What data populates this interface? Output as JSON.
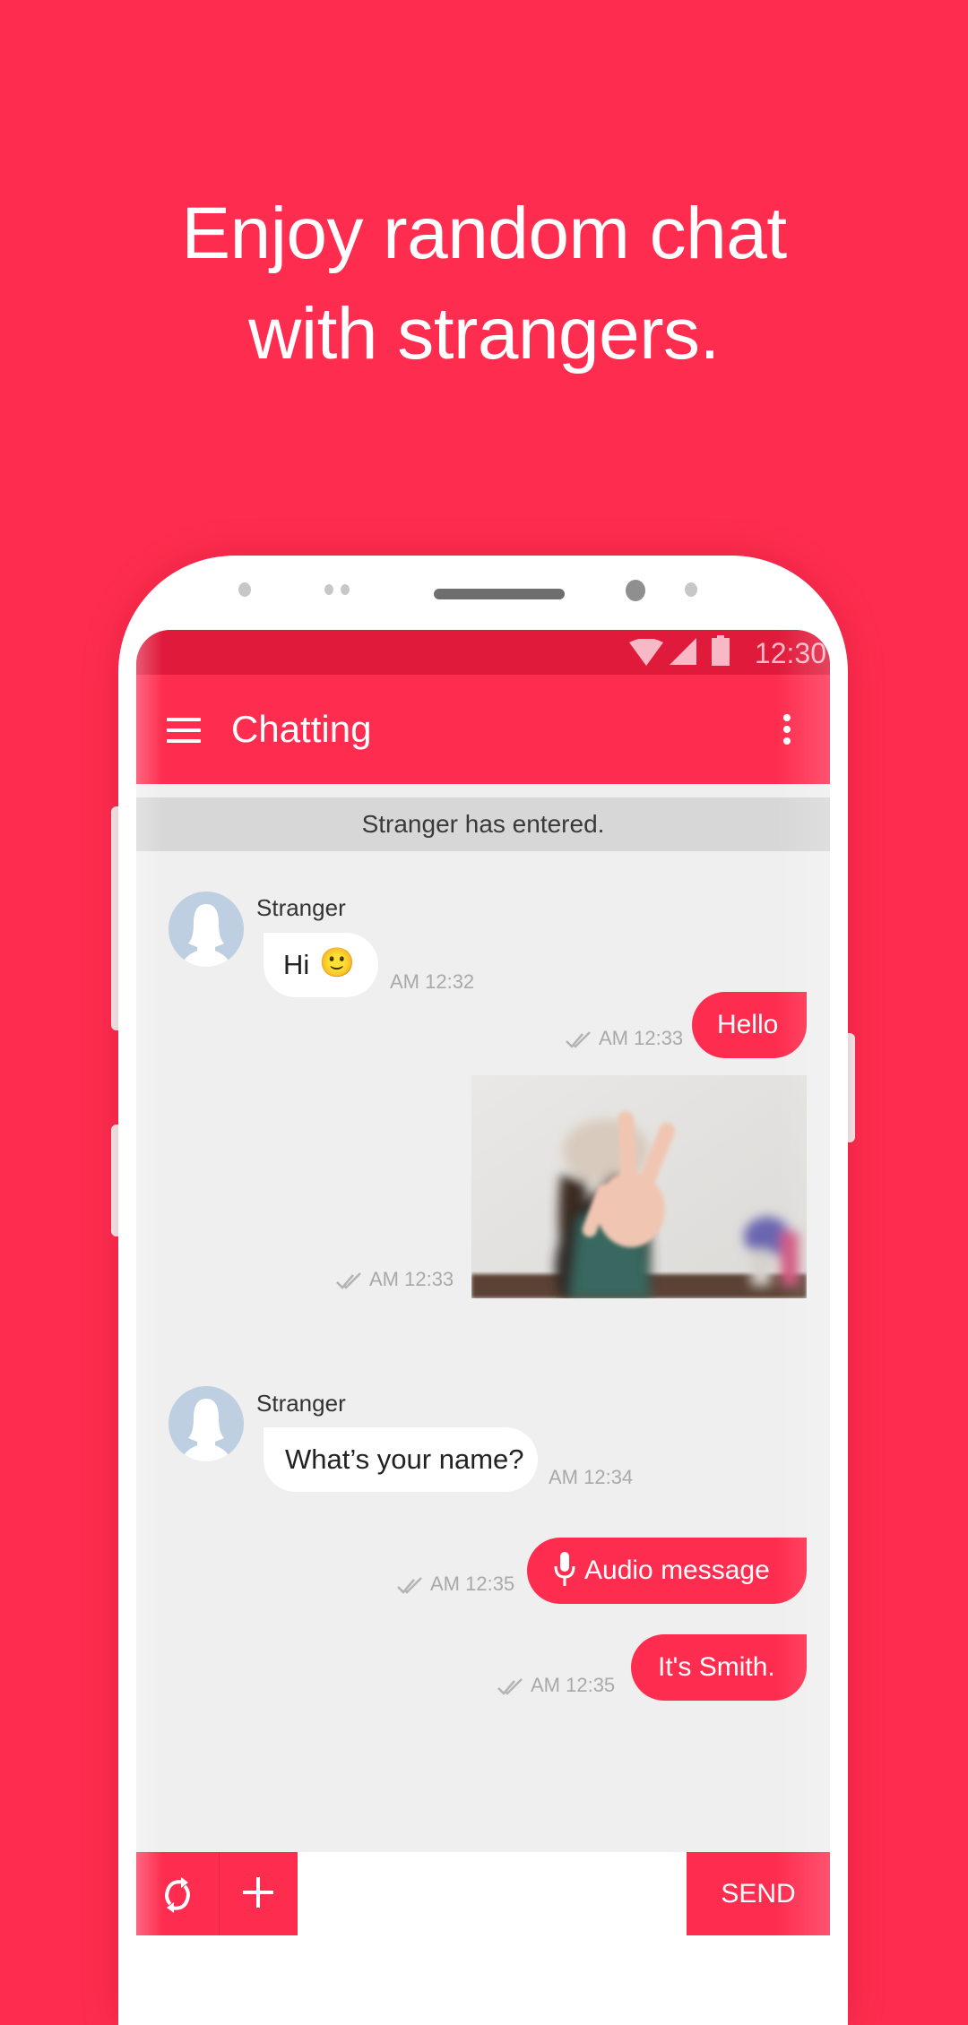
{
  "headline": {
    "line1": "Enjoy random chat",
    "line2": "with strangers."
  },
  "colors": {
    "brand": "#fe2d4f",
    "status_bar": "#e01a3b",
    "system_msg_bg": "#d7d7d7",
    "chat_bg": "#efefef"
  },
  "status_bar": {
    "icons": [
      "wifi-icon",
      "signal-icon",
      "battery-icon"
    ],
    "time": "12:30"
  },
  "app_bar": {
    "menu_icon": "hamburger-menu-icon",
    "title": "Chatting",
    "more_icon": "more-vertical-icon"
  },
  "chat": {
    "system_message": "Stranger has entered.",
    "messages": [
      {
        "direction": "in",
        "sender": "Stranger",
        "text": "Hi",
        "emoji": "🙂",
        "time": "AM 12:32"
      },
      {
        "direction": "out",
        "text": "Hello",
        "time": "AM 12:33",
        "read": true
      },
      {
        "direction": "out",
        "type": "image",
        "image_alt": "Photo of a person making a peace sign",
        "time": "AM 12:33",
        "read": true
      },
      {
        "direction": "in",
        "sender": "Stranger",
        "text": "What’s your name?",
        "time": "AM 12:34"
      },
      {
        "direction": "out",
        "type": "audio",
        "text": "Audio message",
        "icon": "microphone-icon",
        "time": "AM 12:35",
        "read": true
      },
      {
        "direction": "out",
        "text": "It's Smith.",
        "time": "AM 12:35",
        "read": true
      }
    ]
  },
  "input_bar": {
    "refresh_icon": "refresh-icon",
    "add_icon": "plus-icon",
    "input_value": "",
    "input_placeholder": "",
    "send_label": "SEND"
  }
}
